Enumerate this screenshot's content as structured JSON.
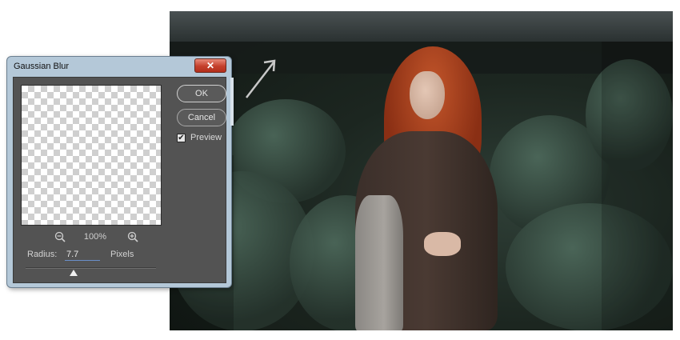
{
  "dialog": {
    "title": "Gaussian Blur",
    "close_label": "✕",
    "ok_label": "OK",
    "cancel_label": "Cancel",
    "preview_label": "Preview",
    "preview_checked": true,
    "preview_check_glyph": "✔",
    "zoom_level": "100%",
    "radius_label": "Radius:",
    "radius_value": "7.7",
    "radius_unit": "Pixels",
    "colors": {
      "titlebar": "#b4c8d8",
      "close_button": "#c4402b",
      "panel": "#535353"
    },
    "icons": {
      "zoom_out": "zoom-out-icon",
      "zoom_in": "zoom-in-icon",
      "close": "close-icon",
      "checkbox": "check-icon"
    }
  },
  "canvas": {
    "annotation": "arrow-icon"
  }
}
